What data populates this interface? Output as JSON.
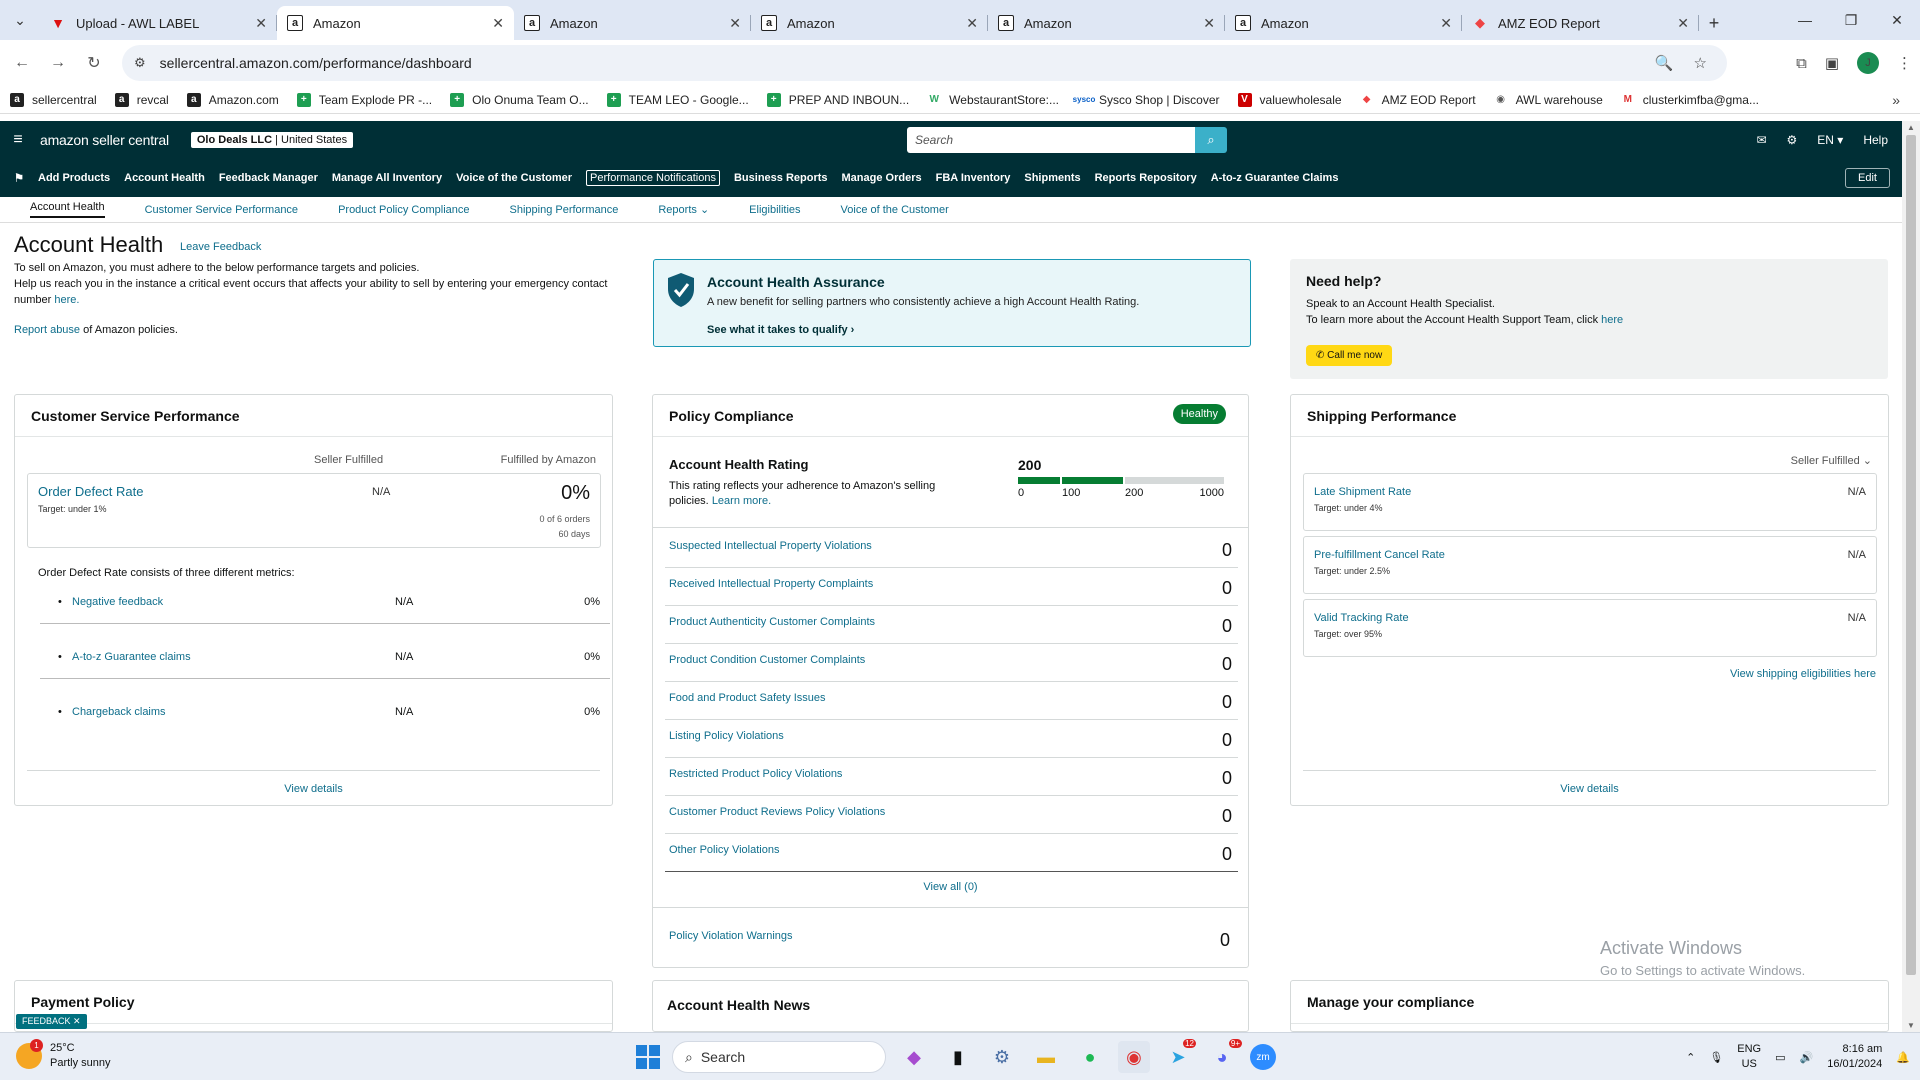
{
  "browser": {
    "tabs": [
      {
        "title": "Upload - AWL LABEL",
        "icon": "awl-icon",
        "active": false
      },
      {
        "title": "Amazon",
        "icon": "amazon-icon",
        "active": true
      },
      {
        "title": "Amazon",
        "icon": "amazon-icon",
        "active": false
      },
      {
        "title": "Amazon",
        "icon": "amazon-icon",
        "active": false
      },
      {
        "title": "Amazon",
        "icon": "amazon-icon",
        "active": false
      },
      {
        "title": "Amazon",
        "icon": "amazon-icon",
        "active": false
      },
      {
        "title": "AMZ EOD Report",
        "icon": "eod-icon",
        "active": false
      }
    ],
    "url": "sellercentral.amazon.com/performance/dashboard",
    "profile_initial": "J",
    "bookmarks": [
      {
        "label": "sellercentral",
        "icon": "amz"
      },
      {
        "label": "revcal",
        "icon": "amz"
      },
      {
        "label": "Amazon.com",
        "icon": "amz"
      },
      {
        "label": "Team Explode PR -...",
        "icon": "sheet"
      },
      {
        "label": "Olo Onuma Team O...",
        "icon": "sheet"
      },
      {
        "label": "TEAM LEO - Google...",
        "icon": "sheet"
      },
      {
        "label": "PREP AND INBOUN...",
        "icon": "sheet"
      },
      {
        "label": "WebstaurantStore:...",
        "icon": "w"
      },
      {
        "label": "Sysco Shop | Discover",
        "icon": "sy"
      },
      {
        "label": "valuewholesale",
        "icon": "vw"
      },
      {
        "label": "AMZ EOD Report",
        "icon": "eod"
      },
      {
        "label": "AWL warehouse",
        "icon": "awl"
      },
      {
        "label": "clusterkimfba@gma...",
        "icon": "gm"
      }
    ]
  },
  "header": {
    "logo": "amazon seller central",
    "store": "Olo Deals LLC",
    "marketplace": "United States",
    "search_placeholder": "Search",
    "lang": "EN",
    "help": "Help"
  },
  "nav": {
    "items": [
      "Add Products",
      "Account Health",
      "Feedback Manager",
      "Manage All Inventory",
      "Voice of the Customer",
      "Performance Notifications",
      "Business Reports",
      "Manage Orders",
      "FBA Inventory",
      "Shipments",
      "Reports Repository",
      "A-to-z Guarantee Claims"
    ],
    "boxed_item": "Performance Notifications",
    "edit": "Edit"
  },
  "subnav": {
    "items": [
      "Account Health",
      "Customer Service Performance",
      "Product Policy Compliance",
      "Shipping Performance",
      "Reports",
      "Eligibilities",
      "Voice of the Customer"
    ]
  },
  "page": {
    "title": "Account Health",
    "leave_feedback": "Leave Feedback",
    "intro_1": "To sell on Amazon, you must adhere to the below performance targets and policies.",
    "intro_2": "Help us reach you in the instance a critical event occurs that affects your ability to sell by entering your emergency contact number",
    "intro_here": "here.",
    "report_abuse": "Report abuse",
    "report_abuse_rest": "of Amazon policies."
  },
  "assurance": {
    "title": "Account Health Assurance",
    "desc": "A new benefit for selling partners who consistently achieve a high Account Health Rating.",
    "link": "See what it takes to qualify"
  },
  "help": {
    "title": "Need help?",
    "line1": "Speak to an Account Health Specialist.",
    "line2": "To learn more about the Account Health Support Team, click",
    "link": "here",
    "call": "Call me now"
  },
  "csp": {
    "title": "Customer Service Performance",
    "col1": "Seller Fulfilled",
    "col2": "Fulfilled by Amazon",
    "odr_name": "Order Defect Rate",
    "odr_target": "Target: under 1%",
    "odr_sf": "N/A",
    "odr_fba": "0%",
    "odr_orders": "0 of 6 orders",
    "odr_days": "60 days",
    "desc": "Order Defect Rate consists of three different metrics:",
    "metrics": [
      {
        "name": "Negative feedback",
        "sf": "N/A",
        "fba": "0%"
      },
      {
        "name": "A-to-z Guarantee claims",
        "sf": "N/A",
        "fba": "0%"
      },
      {
        "name": "Chargeback claims",
        "sf": "N/A",
        "fba": "0%"
      }
    ],
    "view_details": "View details"
  },
  "pc": {
    "title": "Policy Compliance",
    "status": "Healthy",
    "ahr_title": "Account Health Rating",
    "ahr_desc": "This rating reflects your adherence to Amazon's selling policies.",
    "ahr_learn": "Learn more.",
    "score": "200",
    "score_value": 200,
    "scale": [
      "0",
      "100",
      "200",
      "1000"
    ],
    "rows": [
      {
        "label": "Suspected Intellectual Property Violations",
        "count": "0"
      },
      {
        "label": "Received Intellectual Property Complaints",
        "count": "0"
      },
      {
        "label": "Product Authenticity Customer Complaints",
        "count": "0"
      },
      {
        "label": "Product Condition Customer Complaints",
        "count": "0"
      },
      {
        "label": "Food and Product Safety Issues",
        "count": "0"
      },
      {
        "label": "Listing Policy Violations",
        "count": "0"
      },
      {
        "label": "Restricted Product Policy Violations",
        "count": "0"
      },
      {
        "label": "Customer Product Reviews Policy Violations",
        "count": "0"
      },
      {
        "label": "Other Policy Violations",
        "count": "0"
      }
    ],
    "view_all": "View all (0)",
    "warnings_label": "Policy Violation Warnings",
    "warnings_count": "0"
  },
  "sp": {
    "title": "Shipping Performance",
    "filter": "Seller Fulfilled",
    "rows": [
      {
        "name": "Late Shipment Rate",
        "target": "Target: under 4%",
        "value": "N/A"
      },
      {
        "name": "Pre-fulfillment Cancel Rate",
        "target": "Target: under 2.5%",
        "value": "N/A"
      },
      {
        "name": "Valid Tracking Rate",
        "target": "Target: over 95%",
        "value": "N/A"
      }
    ],
    "eligibilities_link": "View shipping eligibilities here",
    "view_details": "View details"
  },
  "bottom": {
    "payment_policy": "Payment Policy",
    "news": "Account Health News",
    "compliance": "Manage your compliance"
  },
  "watermark": {
    "line1": "Activate Windows",
    "line2": "Go to Settings to activate Windows."
  },
  "feedback_tab": "FEEDBACK",
  "taskbar": {
    "temp": "25°C",
    "weather": "Partly sunny",
    "weather_badge": "1",
    "search": "Search",
    "lang1": "ENG",
    "lang2": "US",
    "time": "8:16 am",
    "date": "16/01/2024",
    "telegram_badge": "12",
    "discord_badge": "9+"
  }
}
